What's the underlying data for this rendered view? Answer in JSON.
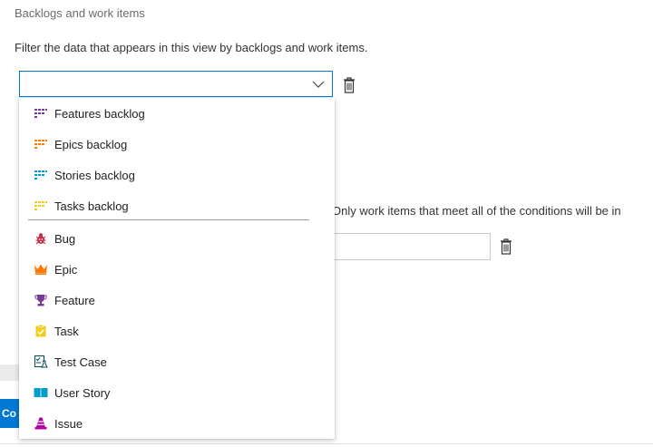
{
  "section": {
    "title": "Backlogs and work items",
    "description": "Filter the data that appears in this view by backlogs and work items."
  },
  "select": {
    "value": ""
  },
  "conditions": {
    "text": "Only work items that meet all of the conditions will be in"
  },
  "footer": {
    "button_label": "Co"
  },
  "dropdown": {
    "backlogs": [
      {
        "label": "Features backlog",
        "icon": "backlog-icon",
        "color": "#773b93"
      },
      {
        "label": "Epics backlog",
        "icon": "backlog-icon",
        "color": "#ff7b00"
      },
      {
        "label": "Stories backlog",
        "icon": "backlog-icon",
        "color": "#009ccc"
      },
      {
        "label": "Tasks backlog",
        "icon": "backlog-icon",
        "color": "#f2cb1d"
      }
    ],
    "work_items": [
      {
        "label": "Bug",
        "icon": "bug-icon",
        "color": "#cc293d"
      },
      {
        "label": "Epic",
        "icon": "crown-icon",
        "color": "#ff7b00"
      },
      {
        "label": "Feature",
        "icon": "trophy-icon",
        "color": "#773b93"
      },
      {
        "label": "Task",
        "icon": "clipboard-icon",
        "color": "#f2cb1d"
      },
      {
        "label": "Test Case",
        "icon": "test-case-icon",
        "color": "#004b50"
      },
      {
        "label": "User Story",
        "icon": "book-icon",
        "color": "#009ccc"
      },
      {
        "label": "Issue",
        "icon": "cone-icon",
        "color": "#b4009e"
      }
    ]
  }
}
